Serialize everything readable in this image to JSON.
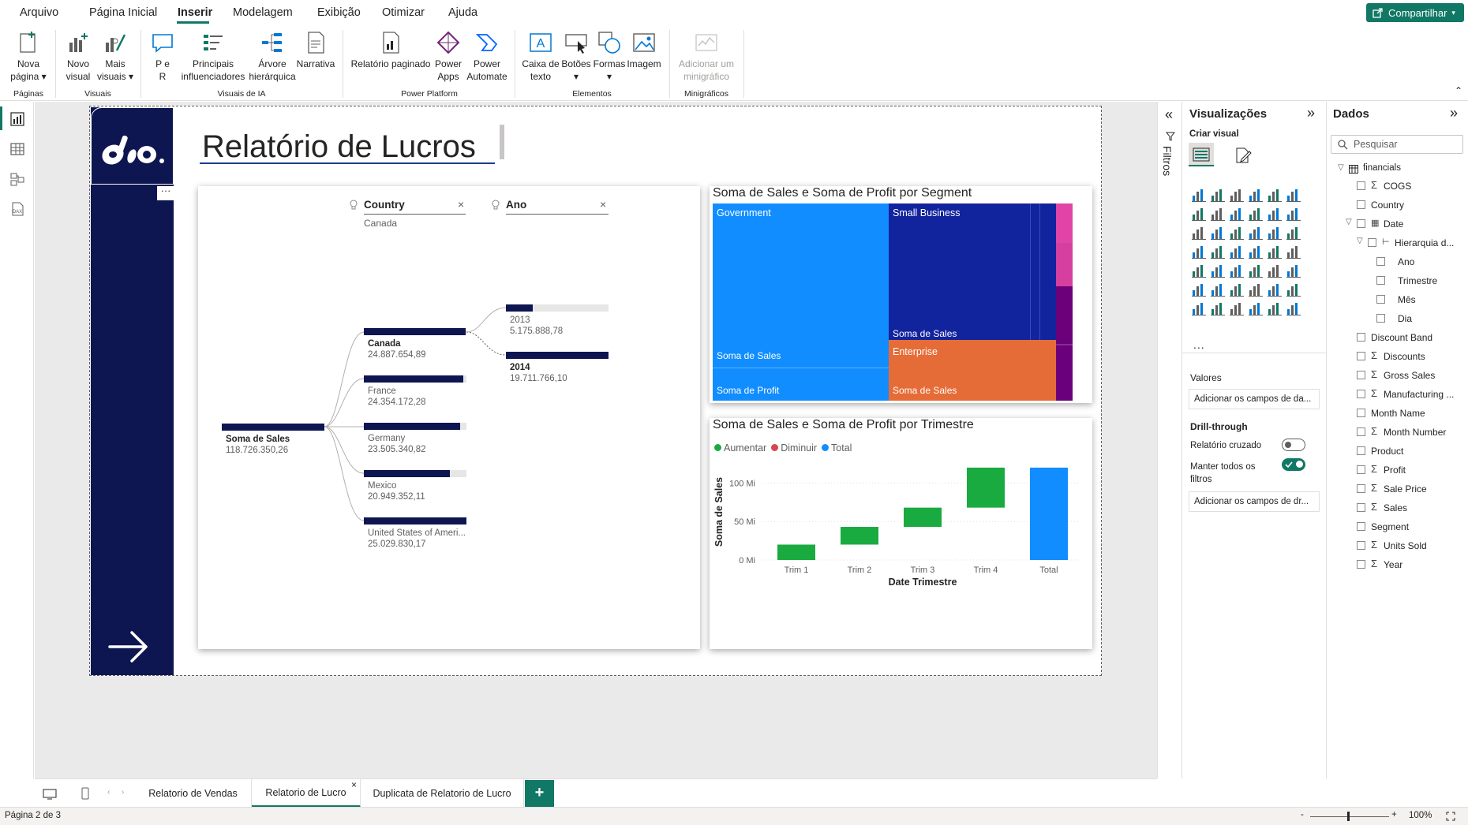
{
  "menu": {
    "items": [
      "Arquivo",
      "Página Inicial",
      "Inserir",
      "Modelagem",
      "Exibição",
      "Otimizar",
      "Ajuda"
    ],
    "active": "Inserir",
    "share_label": "Compartilhar"
  },
  "ribbon": {
    "groups": {
      "paginas": "Páginas",
      "visuais": "Visuais",
      "visuais_ia": "Visuais de IA",
      "power_platform": "Power Platform",
      "elementos": "Elementos",
      "minigraficos": "Minigráficos"
    },
    "buttons": {
      "nova_pagina": [
        "Nova",
        "página ▾"
      ],
      "novo_visual": [
        "Novo",
        "visual"
      ],
      "mais_visuais": [
        "Mais",
        "visuais ▾"
      ],
      "p_e_r": [
        "P e",
        "R"
      ],
      "principais": [
        "Principais",
        "influenciadores"
      ],
      "arvore": [
        "Árvore",
        "hierárquica"
      ],
      "narrativa": [
        "Narrativa",
        ""
      ],
      "relatorio_paginado": [
        "Relatório paginado",
        ""
      ],
      "power_apps": [
        "Power",
        "Apps"
      ],
      "power_automate": [
        "Power",
        "Automate"
      ],
      "caixa_texto": [
        "Caixa de",
        "texto"
      ],
      "botoes": [
        "Botões",
        "▾"
      ],
      "formas": [
        "Formas",
        "▾"
      ],
      "imagem": [
        "Imagem",
        ""
      ],
      "minigrafico": [
        "Adicionar um",
        "minigráfico"
      ]
    }
  },
  "report": {
    "title": "Relatório de Lucros",
    "decomp": {
      "field1_name": "Country",
      "field1_value": "Canada",
      "field2_name": "Ano",
      "root_name": "Soma de Sales",
      "root_value": "118.726.350,26",
      "level1": [
        {
          "name": "Canada",
          "value": "24.887.654,89",
          "fill": 0.99,
          "bold": true
        },
        {
          "name": "France",
          "value": "24.354.172,28",
          "fill": 0.97,
          "bold": false
        },
        {
          "name": "Germany",
          "value": "23.505.340,82",
          "fill": 0.94,
          "bold": false
        },
        {
          "name": "Mexico",
          "value": "20.949.352,11",
          "fill": 0.84,
          "bold": false
        },
        {
          "name": "United States of Ameri...",
          "value": "25.029.830,17",
          "fill": 1.0,
          "bold": false
        }
      ],
      "level2": [
        {
          "name": "2013",
          "value": "5.175.888,78",
          "fill": 0.26,
          "bold": false
        },
        {
          "name": "2014",
          "value": "19.711.766,10",
          "fill": 1.0,
          "bold": true
        }
      ]
    },
    "treemap": {
      "title": "Soma de Sales e Soma de Profit por Segment",
      "government": "Government",
      "small_business": "Small Business",
      "enterprise": "Enterprise",
      "soma_sales": "Soma de Sales",
      "soma_profit": "Soma de Profit",
      "colors": {
        "government": "#118dff",
        "small_business": "#12239e",
        "enterprise": "#e66c37",
        "other1": "#e044a7",
        "other2": "#6b007b"
      }
    },
    "waterfall": {
      "title": "Soma de Sales e Soma de Profit por Trimestre",
      "legend": [
        {
          "label": "Aumentar",
          "color": "#1aab40"
        },
        {
          "label": "Diminuir",
          "color": "#d64550"
        },
        {
          "label": "Total",
          "color": "#118dff"
        }
      ],
      "ylabel": "Soma de Sales",
      "xlabel": "Date Trimestre",
      "yticks": [
        "0 Mi",
        "50 Mi",
        "100 Mi"
      ]
    }
  },
  "chart_data": {
    "type": "bar",
    "title": "Soma de Sales e Soma de Profit por Trimestre",
    "categories": [
      "Trim 1",
      "Trim 2",
      "Trim 3",
      "Trim 4",
      "Total"
    ],
    "series": [
      {
        "name": "Aumentar",
        "values": [
          20,
          23,
          25,
          52,
          null
        ]
      },
      {
        "name": "Total",
        "values": [
          null,
          null,
          null,
          null,
          120
        ]
      }
    ],
    "start": [
      0,
      20,
      43,
      68,
      0
    ],
    "xlabel": "Date Trimestre",
    "ylabel": "Soma de Sales",
    "ylim": [
      0,
      125
    ],
    "yticks": [
      0,
      50,
      100
    ],
    "ytick_labels": [
      "0 Mi",
      "50 Mi",
      "100 Mi"
    ]
  },
  "filters": {
    "label": "Filtros"
  },
  "visualizations": {
    "header": "Visualizações",
    "create_label": "Criar visual",
    "more": "...",
    "values_label": "Valores",
    "values_placeholder": "Adicionar os campos de da...",
    "drill_label": "Drill-through",
    "cross_report": "Relatório cruzado",
    "keep_filters": [
      "Manter todos os",
      "filtros"
    ],
    "drill_placeholder": "Adicionar os campos de dr...",
    "cross_report_on": false,
    "keep_filters_on": true
  },
  "data": {
    "header": "Dados",
    "search_placeholder": "Pesquisar",
    "table": "financials",
    "fields": [
      {
        "name": "COGS",
        "sigma": true,
        "indent": 0
      },
      {
        "name": "Country",
        "sigma": false,
        "indent": 0
      },
      {
        "name": "Date",
        "sigma": false,
        "indent": 0,
        "expand": true,
        "calendar": true
      },
      {
        "name": "Hierarquia d...",
        "sigma": false,
        "indent": 1,
        "expand": true,
        "hier": true
      },
      {
        "name": "Ano",
        "sigma": false,
        "indent": 2
      },
      {
        "name": "Trimestre",
        "sigma": false,
        "indent": 2
      },
      {
        "name": "Mês",
        "sigma": false,
        "indent": 2
      },
      {
        "name": "Dia",
        "sigma": false,
        "indent": 2
      },
      {
        "name": "Discount Band",
        "sigma": false,
        "indent": 0
      },
      {
        "name": "Discounts",
        "sigma": true,
        "indent": 0
      },
      {
        "name": "Gross Sales",
        "sigma": true,
        "indent": 0
      },
      {
        "name": "Manufacturing ...",
        "sigma": true,
        "indent": 0
      },
      {
        "name": "Month Name",
        "sigma": false,
        "indent": 0
      },
      {
        "name": "Month Number",
        "sigma": true,
        "indent": 0
      },
      {
        "name": "Product",
        "sigma": false,
        "indent": 0
      },
      {
        "name": "Profit",
        "sigma": true,
        "indent": 0
      },
      {
        "name": "Sale Price",
        "sigma": true,
        "indent": 0
      },
      {
        "name": "Sales",
        "sigma": true,
        "indent": 0
      },
      {
        "name": "Segment",
        "sigma": false,
        "indent": 0
      },
      {
        "name": "Units Sold",
        "sigma": true,
        "indent": 0
      },
      {
        "name": "Year",
        "sigma": true,
        "indent": 0
      }
    ]
  },
  "tabs": {
    "items": [
      "Relatorio de Vendas",
      "Relatorio de Lucro",
      "Duplicata de Relatorio de Lucro"
    ],
    "active": "Relatorio de Lucro",
    "add_label": "+",
    "close_glyph": "×"
  },
  "status": {
    "page": "Página 2 de 3",
    "zoom": "100%",
    "minus": "-",
    "plus": "+"
  }
}
